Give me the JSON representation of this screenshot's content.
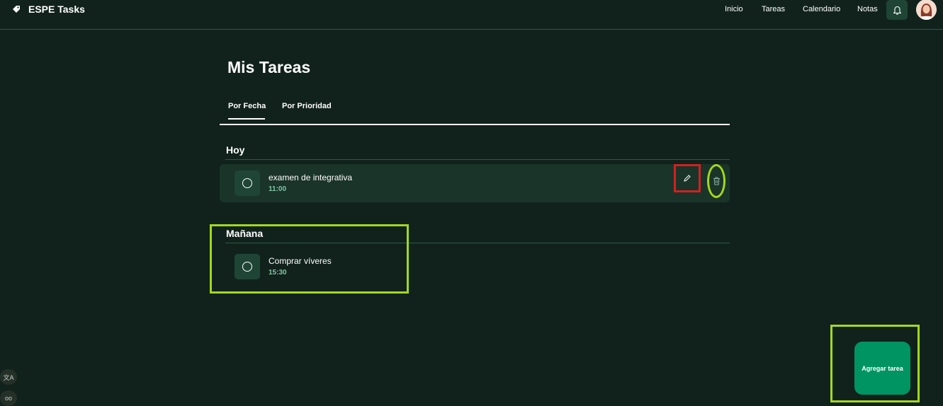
{
  "app": {
    "name": "ESPE Tasks",
    "logo_icon": "tag-icon"
  },
  "nav": {
    "items": [
      "Inicio",
      "Tareas",
      "Calendario",
      "Notas"
    ]
  },
  "header": {
    "notification_icon": "bell-icon",
    "avatar": "user-avatar"
  },
  "page": {
    "title": "Mis Tareas"
  },
  "tabs": [
    {
      "label": "Por Fecha",
      "active": true
    },
    {
      "label": "Por Prioridad",
      "active": false
    }
  ],
  "sections": [
    {
      "title": "Hoy",
      "tasks": [
        {
          "title": "examen de integrativa",
          "time": "11:00"
        }
      ]
    },
    {
      "title": "Mañana",
      "tasks": [
        {
          "title": "Comprar víveres",
          "time": "15:30"
        }
      ]
    }
  ],
  "actions": {
    "add_task_label": "Agregar tarea",
    "edit_icon": "pencil-icon",
    "delete_icon": "trash-icon"
  },
  "side": {
    "translate_label": "文A",
    "extra_label": "oo"
  },
  "colors": {
    "background": "#11221c",
    "accent": "#009463",
    "highlight_green": "#a4d81c",
    "highlight_red": "#d32020",
    "time_text": "#7fc6a3"
  }
}
